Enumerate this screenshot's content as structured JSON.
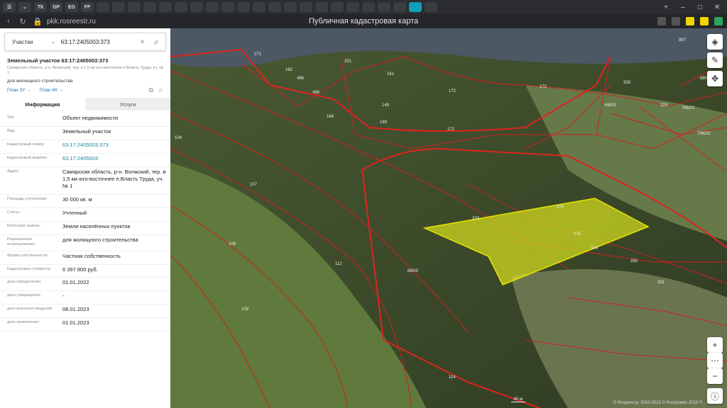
{
  "browser": {
    "tabs": [
      "ТК",
      "GP",
      "EG",
      "FF",
      "",
      "",
      "",
      "",
      "",
      "",
      "",
      "",
      "",
      "",
      "",
      "",
      "",
      "",
      "",
      "",
      "",
      "",
      "",
      "",
      "",
      ""
    ],
    "url": "pkk.rosreestr.ru",
    "title": "Публичная кадастровая карта"
  },
  "search": {
    "type": "Участки",
    "value": "63:17:2405003:373"
  },
  "parcel": {
    "title": "Земельный участок 63:17:2405003:373",
    "address_short": "Самарская область, р-н. Волжский, тер. в 1,5 км юго-восточнее п.Власть Труда, уч. № 1",
    "purpose": "для жилищного строительства",
    "plan_zu": "План ЗУ →",
    "plan_kk": "План КК →"
  },
  "tabs": {
    "info": "Информация",
    "services": "Услуги"
  },
  "rows": [
    {
      "k": "Тип:",
      "v": "Объект недвижимости",
      "link": false
    },
    {
      "k": "Вид:",
      "v": "Земельный участок",
      "link": false
    },
    {
      "k": "Кадастровый номер:",
      "v": "63:17:2405003:373",
      "link": true
    },
    {
      "k": "Кадастровый квартал:",
      "v": "63:17:2405003",
      "link": true
    },
    {
      "k": "Адрес:",
      "v": "Самарская область, р-н. Волжский, тер. в 1,5 км юго-восточнее п.Власть Труда, уч. № 1",
      "link": false
    },
    {
      "k": "Площадь уточненная:",
      "v": "30 000 кв. м",
      "link": false
    },
    {
      "k": "Статус:",
      "v": "Учтенный",
      "link": false
    },
    {
      "k": "Категория земель:",
      "v": "Земли населённых пунктов",
      "link": false
    },
    {
      "k": "Разрешенное использование:",
      "v": "для жилищного строительства",
      "link": false
    },
    {
      "k": "Форма собственности:",
      "v": "Частная собственность",
      "link": false
    },
    {
      "k": "Кадастровая стоимость:",
      "v": "6 397 800 руб.",
      "link": false
    },
    {
      "k": "дата определения:",
      "v": "01.01.2022",
      "link": false
    },
    {
      "k": "дата утверждения:",
      "v": "-",
      "link": false
    },
    {
      "k": "дата внесения сведений:",
      "v": "08.01.2023",
      "link": false
    },
    {
      "k": "дата применения:",
      "v": "01.01.2023",
      "link": false
    }
  ],
  "map": {
    "labels": [
      "162",
      "251",
      "271",
      "486",
      "488",
      "164",
      "149",
      "169",
      "161",
      "172",
      "172",
      "172",
      "326",
      "680/3",
      "7962/2",
      "7962/2",
      "223",
      "897",
      "680",
      "104",
      "107",
      "108",
      "109",
      "112",
      "114",
      "680/3",
      "373",
      "373",
      "375",
      "374",
      "330",
      "331"
    ],
    "scale": "60 м",
    "copyright": "© Росреестр, 2010-2023 © Роскосмос 2018 © ...",
    "accent": "#d9e21c"
  }
}
